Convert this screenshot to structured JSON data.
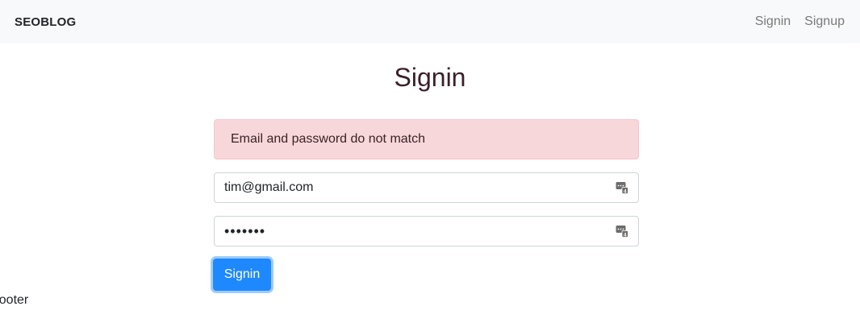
{
  "navbar": {
    "brand": "SEOBLOG",
    "links": [
      {
        "label": "Signin"
      },
      {
        "label": "Signup"
      }
    ]
  },
  "page": {
    "title": "Signin"
  },
  "alert": {
    "message": "Email and password do not match",
    "type": "danger"
  },
  "form": {
    "email": {
      "value": "tim@gmail.com",
      "autofill_icon": "password-manager-icon"
    },
    "password": {
      "value": "•••••••",
      "autofill_icon": "password-manager-icon"
    },
    "submit_label": "Signin"
  },
  "footer": {
    "text": "Footer"
  },
  "colors": {
    "primary": "#1e88ff",
    "alert_bg": "#f8d7da",
    "navbar_bg": "#f8f9fa"
  }
}
